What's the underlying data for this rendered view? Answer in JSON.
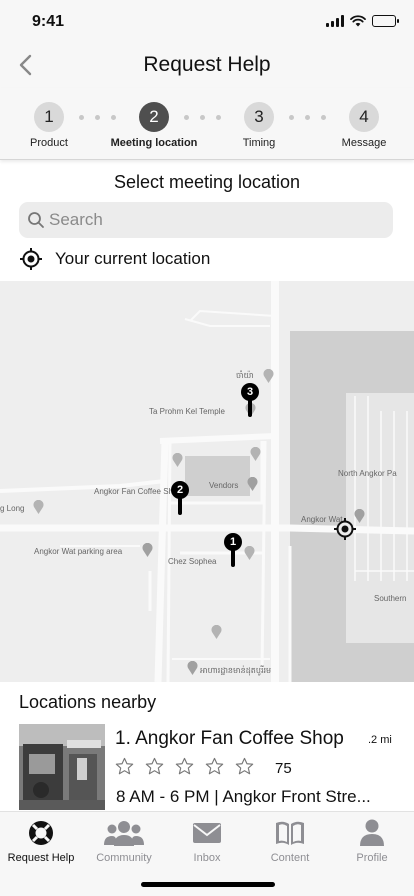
{
  "status_bar": {
    "time": "9:41"
  },
  "header": {
    "title": "Request Help",
    "back_icon": "chevron-left-icon"
  },
  "stepper": {
    "steps": [
      {
        "number": "1",
        "label": "Product",
        "active": false
      },
      {
        "number": "2",
        "label": "Meeting location",
        "active": true
      },
      {
        "number": "3",
        "label": "Timing",
        "active": false
      },
      {
        "number": "4",
        "label": "Message",
        "active": false
      }
    ]
  },
  "main": {
    "title": "Select meeting location",
    "search": {
      "placeholder": "Search",
      "value": ""
    },
    "current_location_label": "Your current location"
  },
  "map": {
    "labels": {
      "temple_script": "ចាំយ៉ា",
      "ta_prohm_kel": "Ta Prohm Kel Temple",
      "vendors": "Vendors",
      "angkor_fan": "Angkor Fan Coffee Shop",
      "long": "g Long",
      "angkor_wat_parking": "Angkor Wat parking area",
      "chez_sophea": "Chez Sophea",
      "north_angkor": "North Angkor Pa",
      "angkor_wat": "Angkor Wat",
      "southern": "Southern",
      "khmer_bottom": "អាហារដ្ឋានមាន់ដុតបូរីរម"
    },
    "pins": [
      {
        "number": "1"
      },
      {
        "number": "2"
      },
      {
        "number": "3"
      }
    ]
  },
  "nearby": {
    "title": "Locations nearby",
    "items": [
      {
        "name": "1. Angkor Fan Coffee Shop",
        "distance": ".2 mi",
        "rating": 0,
        "rating_max": 5,
        "reviews": "75",
        "hours": "8 AM - 6 PM | Angkor Front Stre..."
      }
    ]
  },
  "tabbar": {
    "tabs": [
      {
        "label": "Request Help",
        "icon": "lifebuoy-icon",
        "active": true
      },
      {
        "label": "Community",
        "icon": "people-icon",
        "active": false
      },
      {
        "label": "Inbox",
        "icon": "mail-icon",
        "active": false
      },
      {
        "label": "Content",
        "icon": "book-icon",
        "active": false
      },
      {
        "label": "Profile",
        "icon": "person-icon",
        "active": false
      }
    ]
  },
  "colors": {
    "active_step": "#4f4f4f",
    "inactive_step": "#d9d9d9",
    "map_bg": "#eeeeee",
    "tab_inactive": "#8e8e93"
  }
}
